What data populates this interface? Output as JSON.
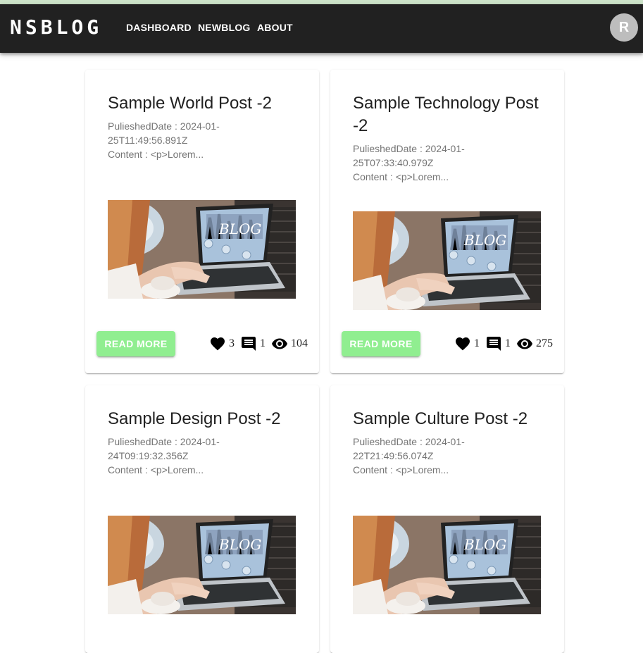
{
  "app": {
    "brand": "NSBLOG",
    "nav": [
      "DASHBOARD",
      "NEWBLOG",
      "ABOUT"
    ],
    "avatar_initial": "R"
  },
  "colors": {
    "appbar": "#212121",
    "read_more_button": "#90ee90",
    "avatar": "#bdbdbd"
  },
  "posts": [
    {
      "title": "Sample World Post -2",
      "date_line": "PulieshedDate : 2024-01-",
      "date_line2": "25T11:49:56.891Z",
      "content": "Content : <p>Lorem...",
      "image_icon": "blog-laptop-image",
      "button": "READ MORE",
      "likes": "3",
      "comments": "1",
      "views": "104"
    },
    {
      "title": "Sample Technology Post",
      "title2": "-2",
      "date_line": "PulieshedDate : 2024-01-",
      "date_line2": "25T07:33:40.979Z",
      "content": "Content : <p>Lorem...",
      "image_icon": "blog-laptop-image",
      "button": "READ MORE",
      "likes": "1",
      "comments": "1",
      "views": "275"
    },
    {
      "title": "Sample Design Post -2",
      "date_line": "PulieshedDate : 2024-01-",
      "date_line2": "24T09:19:32.356Z",
      "content": "Content : <p>Lorem...",
      "image_icon": "blog-laptop-image"
    },
    {
      "title": "Sample Culture Post -2",
      "date_line": "PulieshedDate : 2024-01-",
      "date_line2": "22T21:49:56.074Z",
      "content": "Content : <p>Lorem...",
      "image_icon": "blog-laptop-image"
    }
  ],
  "icons": [
    "heart-icon",
    "comment-icon",
    "eye-icon"
  ]
}
